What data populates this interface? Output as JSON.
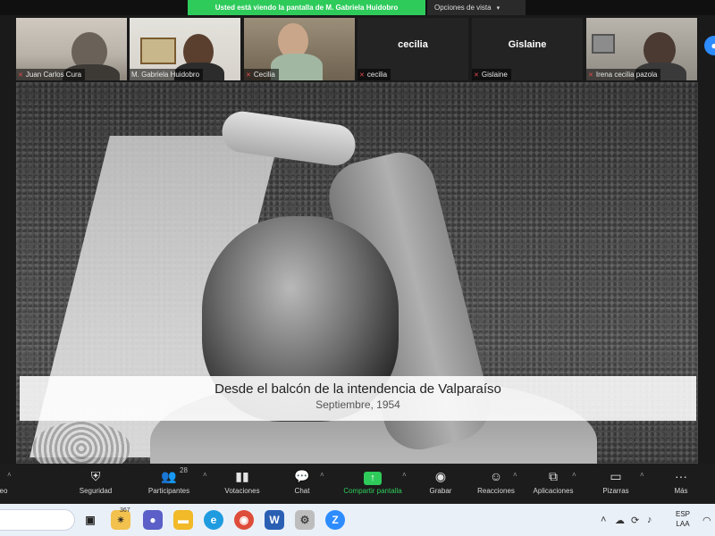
{
  "banner": {
    "share_text": "Usted está viendo la pantalla de M. Gabriela Huidobro",
    "view_options": "Opciones de vista"
  },
  "participants": [
    {
      "name": "Juan Carlos Cura",
      "video": true
    },
    {
      "name": "M. Gabriela Huidobro",
      "video": true
    },
    {
      "name": "Cecilia",
      "video": true
    },
    {
      "name": "cecilia",
      "video": false,
      "display": "cecilia"
    },
    {
      "name": "Gislaine",
      "video": false,
      "display": "Gislaine"
    },
    {
      "name": "Irena cecilia pazola",
      "video": true
    }
  ],
  "slide": {
    "caption_title": "Desde el balcón de la intendencia de Valparaíso",
    "caption_subtitle": "Septiembre, 1954"
  },
  "toolbar": {
    "items": [
      {
        "label": "eo",
        "icon": "video-icon"
      },
      {
        "label": "Seguridad",
        "icon": "shield-icon"
      },
      {
        "label": "Participantes",
        "icon": "participants-icon",
        "count": "28"
      },
      {
        "label": "Votaciones",
        "icon": "polls-icon"
      },
      {
        "label": "Chat",
        "icon": "chat-icon"
      },
      {
        "label": "Compartir pantalla",
        "icon": "share-screen-icon"
      },
      {
        "label": "Grabar",
        "icon": "record-icon"
      },
      {
        "label": "Reacciones",
        "icon": "reactions-icon"
      },
      {
        "label": "Aplicaciones",
        "icon": "apps-icon"
      },
      {
        "label": "Pizarras",
        "icon": "whiteboard-icon"
      },
      {
        "label": "Más",
        "icon": "more-icon"
      }
    ]
  },
  "taskbar": {
    "badge": "367",
    "lang_top": "ESP",
    "lang_bottom": "LAA"
  },
  "colors": {
    "share_green": "#2ecb5b",
    "mic_off_red": "#e5484d",
    "zoom_blue": "#2d8cff"
  }
}
